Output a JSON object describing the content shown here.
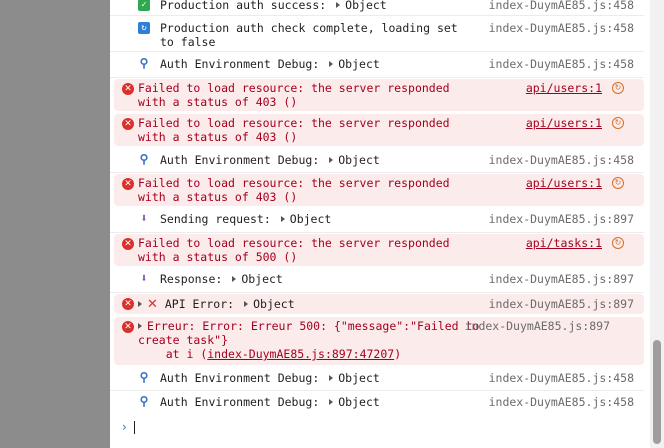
{
  "messages": [
    {
      "kind": "log",
      "icon": "check",
      "text": "Production auth success:",
      "object": "Object",
      "source": "index-DuymAE85.js:458"
    },
    {
      "kind": "log",
      "icon": "refresh",
      "text": "Production auth check complete, loading set to false",
      "source": "index-DuymAE85.js:458"
    },
    {
      "kind": "log",
      "icon": "magnifier",
      "text": "Auth Environment Debug:",
      "object": "Object",
      "source": "index-DuymAE85.js:458"
    },
    {
      "kind": "error",
      "text": "Failed to load resource: the server responded with a status of 403 ()",
      "source": "api/users:1"
    },
    {
      "kind": "error",
      "text": "Failed to load resource: the server responded with a status of 403 ()",
      "source": "api/users:1"
    },
    {
      "kind": "log",
      "icon": "magnifier",
      "text": "Auth Environment Debug:",
      "object": "Object",
      "source": "index-DuymAE85.js:458"
    },
    {
      "kind": "error",
      "text": "Failed to load resource: the server responded with a status of 403 ()",
      "source": "api/users:1"
    },
    {
      "kind": "log",
      "icon": "inbox",
      "text": "Sending request:",
      "object": "Object",
      "source": "index-DuymAE85.js:897"
    },
    {
      "kind": "error",
      "text": "Failed to load resource: the server responded with a status of 500 ()",
      "source": "api/tasks:1"
    },
    {
      "kind": "log",
      "icon": "inbox",
      "text": "Response:",
      "object": "Object",
      "source": "index-DuymAE85.js:897"
    },
    {
      "kind": "error",
      "text": "API Error:",
      "object": "Object",
      "source": "index-DuymAE85.js:897"
    },
    {
      "kind": "error",
      "text": "Erreur: Error: Erreur 500: {\"message\":\"Failed to create task\"}",
      "trace_prefix": "    at i (",
      "trace_link": "index-DuymAE85.js:897:47207",
      "trace_suffix": ")",
      "source": "index-DuymAE85.js:897"
    },
    {
      "kind": "log",
      "icon": "magnifier",
      "text": "Auth Environment Debug:",
      "object": "Object",
      "source": "index-DuymAE85.js:458"
    },
    {
      "kind": "log",
      "icon": "magnifier",
      "text": "Auth Environment Debug:",
      "object": "Object",
      "source": "index-DuymAE85.js:458"
    }
  ],
  "prompt": {
    "symbol": "›"
  }
}
